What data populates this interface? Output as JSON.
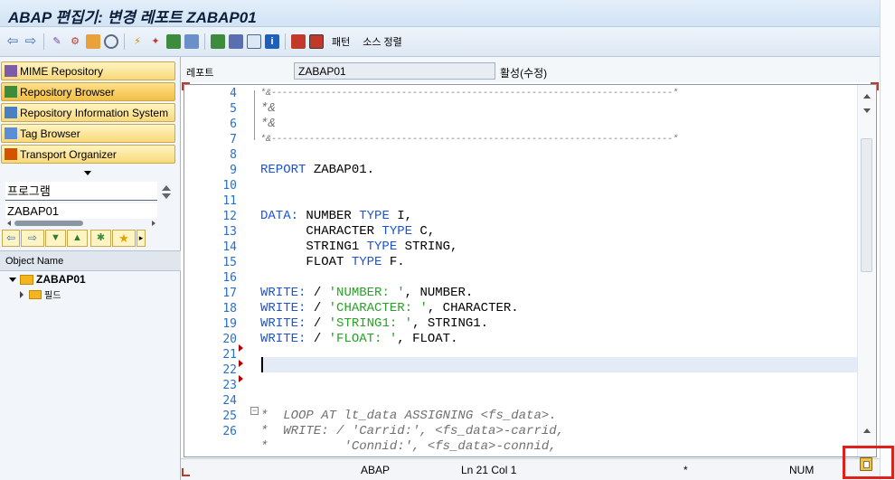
{
  "window": {
    "title": "ABAP 편집기: 변경 레포트 ZABAP01"
  },
  "toolbar": {
    "pattern_label": "패턴",
    "pretty_print_label": "소스 정렬"
  },
  "repository": {
    "buttons": [
      {
        "label": "MIME Repository"
      },
      {
        "label": "Repository Browser"
      },
      {
        "label": "Repository Information System"
      },
      {
        "label": "Tag Browser"
      },
      {
        "label": "Transport Organizer"
      }
    ],
    "object_type_value": "프로그램",
    "object_name_value": "ZABAP01",
    "column_header": "Object Name",
    "tree": {
      "root": "ZABAP01",
      "child": "필드"
    }
  },
  "editor": {
    "report_label": "레포트",
    "report_value": "ZABAP01",
    "status_label": "활성(수정)",
    "line_numbers": [
      "4",
      "5",
      "6",
      "7",
      "8",
      "9",
      "10",
      "11",
      "12",
      "13",
      "14",
      "15",
      "16",
      "17",
      "18",
      "19",
      "20",
      "21",
      "22",
      "23",
      "24",
      "25",
      "26"
    ],
    "code": {
      "l4": "*&--------------------------------------------------------------------------*",
      "l5": "*&",
      "l6": "*&",
      "l7": "*&--------------------------------------------------------------------------*",
      "l9_kw": "REPORT",
      "l9_rest": " ZABAP01.",
      "l12_kw": "DATA:",
      "l12_a": " NUMBER ",
      "l12_kw2": "TYPE",
      "l12_b": " I,",
      "l13_a": "      CHARACTER ",
      "l13_kw": "TYPE",
      "l13_b": " C,",
      "l14_a": "      STRING1 ",
      "l14_kw": "TYPE",
      "l14_b": " STRING,",
      "l15_a": "      FLOAT ",
      "l15_kw": "TYPE",
      "l15_b": " F.",
      "write_kw": "WRITE:",
      "write_slash": " / ",
      "l17_str": "'NUMBER: '",
      "l17_var": ", NUMBER.",
      "l18_str": "'CHARACTER: '",
      "l18_var": ", CHARACTER.",
      "l19_str": "'STRING1: '",
      "l19_var": ", STRING1.",
      "l20_str": "'FLOAT: '",
      "l20_var": ", FLOAT.",
      "l24": "*  LOOP AT lt_data ASSIGNING <fs_data>.",
      "l25": "*  WRITE: / 'Carrid:', <fs_data>-carrid,",
      "l26": "*          'Connid:', <fs_data>-connid,"
    }
  },
  "statusbar": {
    "language": "ABAP",
    "position": "Ln  21 Col   1",
    "insert_flag": "*",
    "num_lock": "NUM"
  },
  "colors": {
    "keyword": "#1c52d6",
    "string": "#26a326",
    "line_number": "#2a6fc9",
    "highlight_box": "#e0201c"
  }
}
